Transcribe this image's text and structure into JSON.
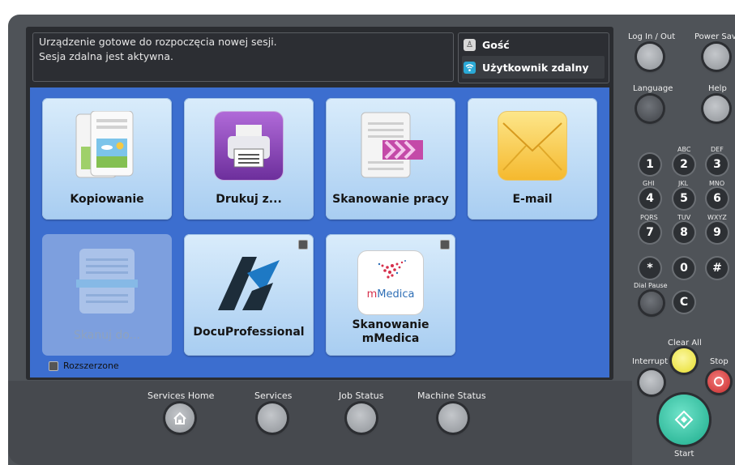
{
  "status": {
    "line1": "Urządzenie gotowe do rozpoczęcia nowej sesji.",
    "line2": "Sesja zdalna jest aktywna."
  },
  "user": {
    "guest": "Gość",
    "remote": "Użytkownik zdalny"
  },
  "tiles": {
    "copy": "Kopiowanie",
    "print": "Drukuj z...",
    "scan_work": "Skanowanie pracy",
    "email": "E-mail",
    "scan_to": "Skanuj do...",
    "docu": "DocuProfessional",
    "mmedica_line1": "Skanowanie",
    "mmedica_line2": "mMedica",
    "mmedica_logo": "mMedica"
  },
  "footer": {
    "extended": "Rozszerzone"
  },
  "bottom_buttons": {
    "services_home": "Services Home",
    "services": "Services",
    "job_status": "Job Status",
    "machine_status": "Machine Status"
  },
  "panel": {
    "log_in_out": "Log In / Out",
    "power_saver": "Power Saver",
    "language": "Language",
    "help": "Help",
    "dial_pause": "Dial Pause",
    "clear_all": "Clear All",
    "interrupt": "Interrupt",
    "stop": "Stop",
    "start": "Start"
  },
  "keypad": {
    "k1": "1",
    "k2": "2",
    "k3": "3",
    "k4": "4",
    "k5": "5",
    "k6": "6",
    "k7": "7",
    "k8": "8",
    "k9": "9",
    "star": "*",
    "k0": "0",
    "hash": "#",
    "c": "C",
    "l2": "ABC",
    "l3": "DEF",
    "l4": "GHI",
    "l5": "JKL",
    "l6": "MNO",
    "l7": "PQRS",
    "l8": "TUV",
    "l9": "WXYZ"
  }
}
